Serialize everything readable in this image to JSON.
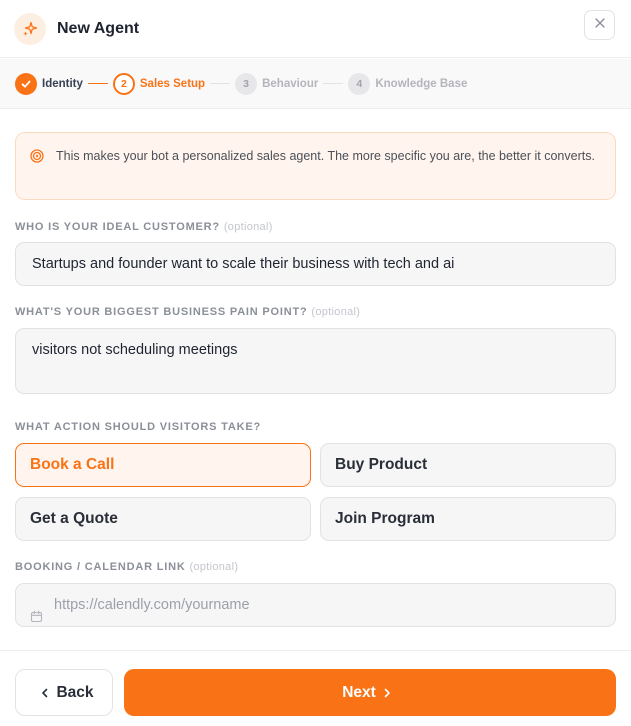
{
  "header": {
    "title": "New Agent",
    "logo_icon": "sparkles-icon",
    "close_icon": "close-icon"
  },
  "stepper": {
    "steps": [
      {
        "number": "✓",
        "label": "Identity",
        "state": "done"
      },
      {
        "number": "2",
        "label": "Sales Setup",
        "state": "active"
      },
      {
        "number": "3",
        "label": "Behaviour",
        "state": "todo"
      },
      {
        "number": "4",
        "label": "Knowledge Base",
        "state": "todo"
      }
    ]
  },
  "tip": {
    "icon": "target-icon",
    "text": "This makes your bot a personalized sales agent. The more specific you are, the better it converts."
  },
  "fields": {
    "ideal_customer": {
      "label": "WHO IS YOUR IDEAL CUSTOMER?",
      "optional": "(optional)",
      "value": "Startups and founder want to scale their business with tech and ai"
    },
    "pain_point": {
      "label": "WHAT'S YOUR BIGGEST BUSINESS PAIN POINT?",
      "optional": "(optional)",
      "value": "visitors not scheduling meetings"
    },
    "action": {
      "label": "WHAT ACTION SHOULD VISITORS TAKE?",
      "options": [
        "Book a Call",
        "Buy Product",
        "Get a Quote",
        "Join Program"
      ],
      "selected": "Book a Call"
    },
    "booking_link": {
      "label": "BOOKING / CALENDAR LINK",
      "optional": "(optional)",
      "placeholder": "https://calendly.com/yourname",
      "icon": "calendar-icon"
    }
  },
  "footer": {
    "back_label": "Back",
    "next_label": "Next"
  },
  "colors": {
    "accent": "#f97316",
    "accent_bg": "#fff5ee"
  }
}
